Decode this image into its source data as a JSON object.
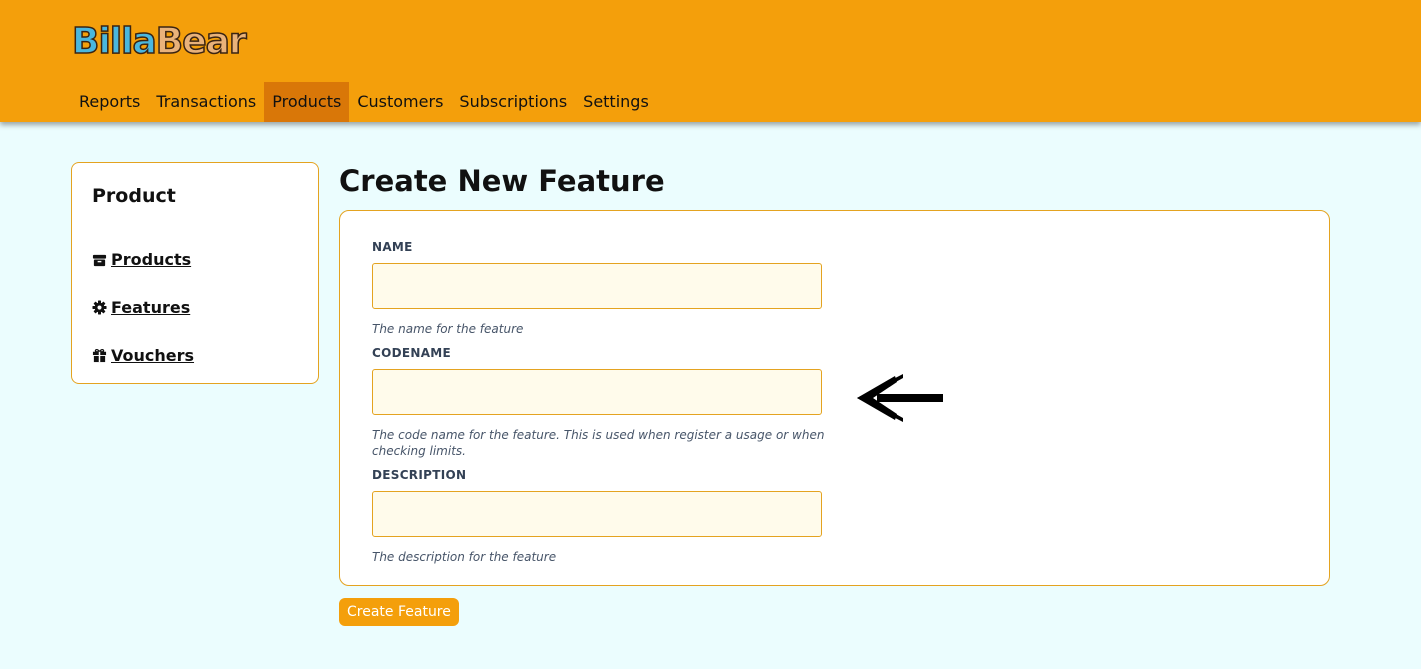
{
  "brand": {
    "part1": "Billa",
    "part2": "Bear"
  },
  "nav": {
    "items": [
      {
        "label": "Reports"
      },
      {
        "label": "Transactions"
      },
      {
        "label": "Products"
      },
      {
        "label": "Customers"
      },
      {
        "label": "Subscriptions"
      },
      {
        "label": "Settings"
      }
    ],
    "active": "Products"
  },
  "sidebar": {
    "title": "Product",
    "links": [
      {
        "label": "Products",
        "icon": "box-icon"
      },
      {
        "label": "Features",
        "icon": "gear-icon"
      },
      {
        "label": "Vouchers",
        "icon": "gift-icon"
      }
    ]
  },
  "form": {
    "title": "Create New Feature",
    "fields": [
      {
        "label": "NAME",
        "value": "",
        "help": "The name for the feature"
      },
      {
        "label": "CODENAME",
        "value": "",
        "help": "The code name for the feature. This is used when register a usage or when checking limits."
      },
      {
        "label": "DESCRIPTION",
        "value": "",
        "help": "The description for the feature"
      }
    ],
    "submit_label": "Create Feature"
  },
  "colors": {
    "header": "#f49f0b",
    "nav_active": "#d97708",
    "background": "#ebfdfe",
    "border": "#e4a320",
    "input_bg": "#fffbeb"
  },
  "annotation": {
    "icon": "arrow-left-icon"
  }
}
